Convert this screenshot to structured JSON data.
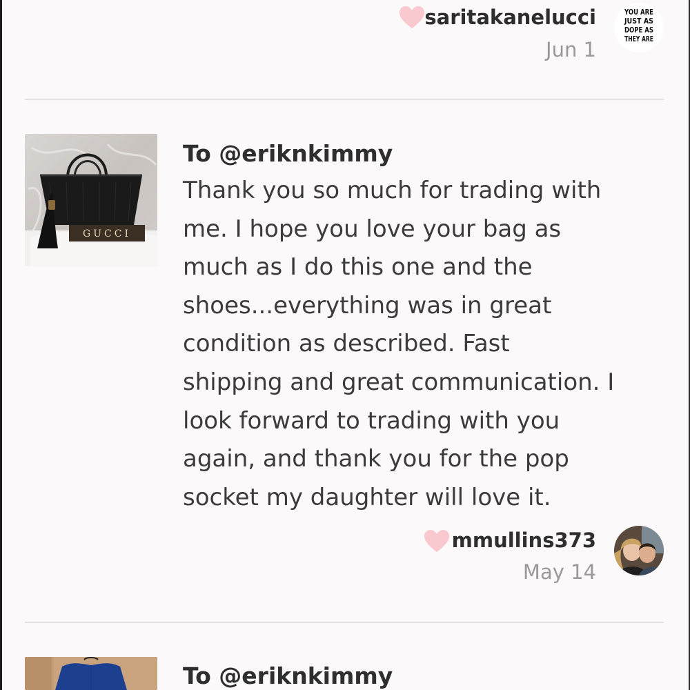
{
  "reviews": [
    {
      "reviewer": "saritakanelucci",
      "date": "Jun 1",
      "avatar_text": [
        "YOU ARE",
        "JUST AS",
        "DOPE AS",
        "THEY ARE"
      ]
    },
    {
      "to": "To @eriknkimmy",
      "message_lines": [
        "Thank you so much for trading with",
        "me. I hope you love your bag as",
        "much as I do this one and the",
        "shoes...everything was in great",
        "condition as described. Fast",
        "shipping and great communication. I",
        "look forward to trading with you",
        "again, and thank you for the pop",
        "socket my daughter will love it."
      ],
      "thumbnail_brand_text": "GUCCI",
      "reviewer": "mmullins373",
      "date": "May 14"
    },
    {
      "to": "To @eriknkimmy"
    }
  ],
  "colors": {
    "background": "#fbf9fa",
    "heart": "#f9c9cf",
    "divider": "#e3e1e2",
    "text_primary": "#2e2e2e",
    "text_muted": "#9a9898"
  },
  "icons": {
    "like": "heart-icon"
  }
}
